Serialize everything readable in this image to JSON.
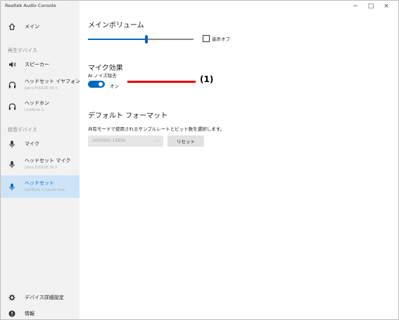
{
  "window": {
    "title": "Realtek Audio Console",
    "controls": {
      "minimize": "−",
      "maximize": "□",
      "close": "×"
    }
  },
  "sidebar": {
    "home": "メイン",
    "playback_head": "再生デバイス",
    "playback": [
      {
        "label": "スピーカー",
        "sub": ""
      },
      {
        "label": "ヘッドセット イヤフォン",
        "sub": "Jabra EVOLVE 30 II"
      },
      {
        "label": "ヘッドホン",
        "sub": "LinkBuds S"
      }
    ],
    "record_head": "録音デバイス",
    "record": [
      {
        "label": "マイク",
        "sub": ""
      },
      {
        "label": "ヘッドセット マイク",
        "sub": "Jabra EVOLVE 30 II"
      },
      {
        "label": "ヘッドセット",
        "sub": "LinkBuds S Hands-Free",
        "selected": true
      }
    ],
    "device_settings": "デバイス詳細設定",
    "info": "情報"
  },
  "main": {
    "volume_title": "メインボリューム",
    "volume_level": 0.55,
    "mute_label": "音声オフ",
    "mute_checked": false,
    "mic_effect_title": "マイク効果",
    "ai_noise_label": "AI ノイズ除去",
    "toggle_on": true,
    "toggle_text": "オン",
    "default_format_title": "デフォルト フォーマット",
    "format_desc": "共有モードで使用されるサンプルレートとビット数を選択します。",
    "format_value": "16000Hz 16Bits",
    "reset_label": "リセット"
  },
  "annotation": {
    "label": "(1)"
  },
  "colors": {
    "accent": "#0067c0",
    "callout": "#e00000",
    "sidebar_bg": "#f2f2f2",
    "selected_bg": "#cde4f7"
  }
}
